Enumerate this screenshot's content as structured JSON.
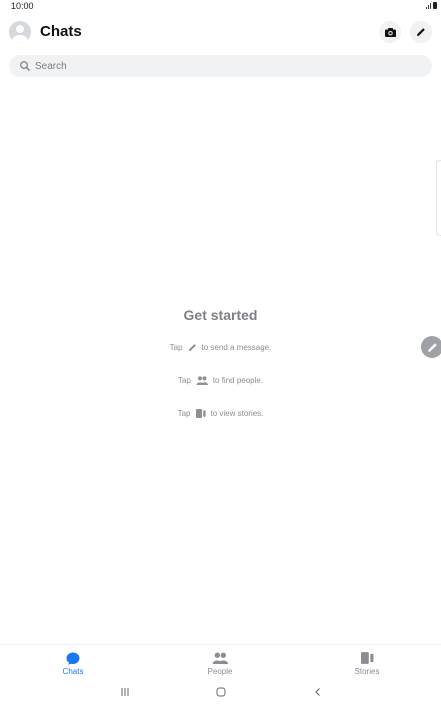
{
  "status_bar": {
    "time": "10:00",
    "icons": [
      "signal-icon",
      "battery-icon"
    ]
  },
  "header": {
    "title": "Chats",
    "avatar_icon": "avatar",
    "actions": [
      {
        "name": "camera-button",
        "icon": "camera-icon"
      },
      {
        "name": "compose-button",
        "icon": "pencil-icon"
      }
    ]
  },
  "search": {
    "placeholder": "Search",
    "value": "",
    "icon": "search-icon"
  },
  "empty_state": {
    "title": "Get started",
    "hints": [
      {
        "prefix": "Tap",
        "icon": "pencil-icon",
        "suffix": "to send a message."
      },
      {
        "prefix": "Tap",
        "icon": "people-icon",
        "suffix": "to find people."
      },
      {
        "prefix": "Tap",
        "icon": "stories-icon",
        "suffix": "to view stories."
      }
    ]
  },
  "bottom_nav": {
    "tabs": [
      {
        "label": "Chats",
        "icon": "chat-bubble-icon",
        "active": true
      },
      {
        "label": "People",
        "icon": "people-icon",
        "active": false
      },
      {
        "label": "Stories",
        "icon": "stories-icon",
        "active": false
      }
    ]
  },
  "system_nav": {
    "buttons": [
      "recents-icon",
      "home-icon",
      "back-icon"
    ]
  },
  "colors": {
    "accent": "#1877f2",
    "inactive": "#8a8d91",
    "search_bg": "#f1f2f4",
    "empty_text": "#7c7f84"
  }
}
